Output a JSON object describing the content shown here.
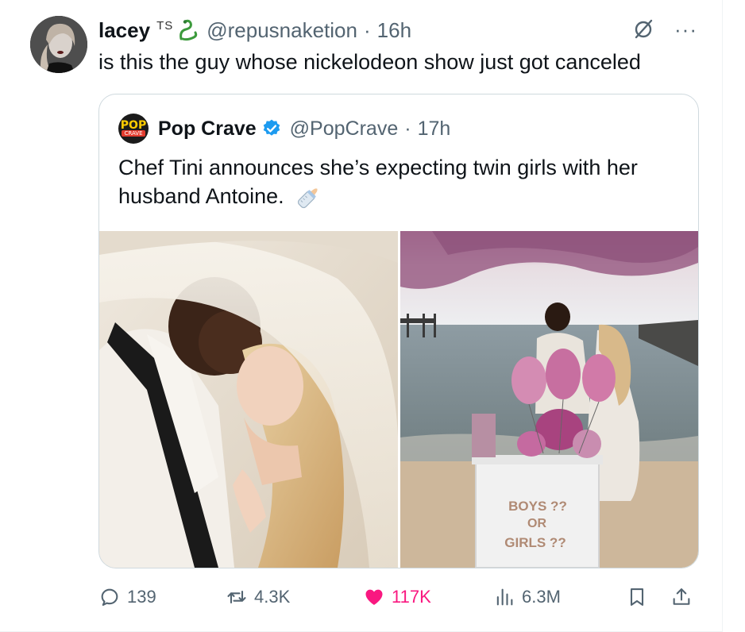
{
  "tweet": {
    "display_name": "lacey",
    "name_emoji": "TS",
    "handle": "@repusnaketion",
    "dot": "·",
    "time": "16h",
    "text": "is this the guy whose nickelodeon show just got canceled",
    "more_label": "···"
  },
  "quote": {
    "avatar_top": "POP",
    "avatar_bottom": "CRAVE",
    "display_name": "Pop Crave",
    "handle": "@PopCrave",
    "dot": "·",
    "time": "17h",
    "text": "Chef Tini announces she’s expecting twin girls with her husband Antoine.",
    "image2_box_text": [
      "BOYS ??",
      "OR",
      "GIRLS ??"
    ]
  },
  "actions": {
    "replies": "139",
    "reposts": "4.3K",
    "likes": "117K",
    "views": "6.3M"
  },
  "colors": {
    "text": "#0f1419",
    "secondary": "#536471",
    "verified": "#1d9bf0",
    "like": "#f91880",
    "border": "#cfd9de"
  }
}
